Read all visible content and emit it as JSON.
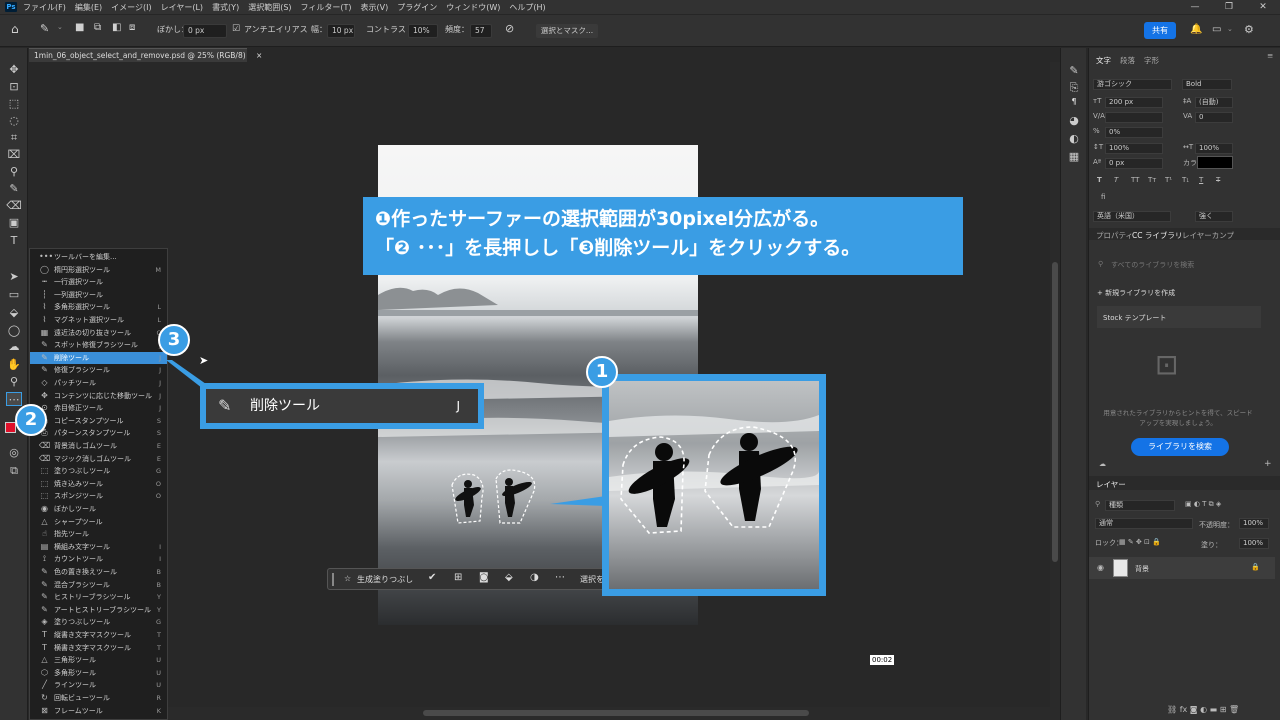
{
  "menu": {
    "app_icon": "Ps",
    "items": [
      "ファイル(F)",
      "編集(E)",
      "イメージ(I)",
      "レイヤー(L)",
      "書式(Y)",
      "選択範囲(S)",
      "フィルター(T)",
      "表示(V)",
      "プラグイン",
      "ウィンドウ(W)",
      "ヘルプ(H)"
    ]
  },
  "options": {
    "feather_label": "ぼかし：",
    "feather_value": "0 px",
    "antialias_label": "アンチエイリアス",
    "width_label": "幅：",
    "width_value": "10 px",
    "contrast_label": "コントラスト：",
    "contrast_value": "10%",
    "frequency_label": "頻度：",
    "frequency_value": "57",
    "select_mask_button": "選択とマスク...",
    "share_button": "共有"
  },
  "document": {
    "tab_title": "1min_06_object_select_and_remove.psd @ 25% (RGB/8)",
    "close": "×"
  },
  "flyout": {
    "items": [
      {
        "icon": "•••",
        "label": "ツールバーを編集...",
        "key": ""
      },
      {
        "icon": "◯",
        "label": "楕円形選択ツール",
        "key": "M"
      },
      {
        "icon": "┅",
        "label": "一行選択ツール",
        "key": ""
      },
      {
        "icon": "┆",
        "label": "一列選択ツール",
        "key": ""
      },
      {
        "icon": "⌇",
        "label": "多角形選択ツール",
        "key": "L"
      },
      {
        "icon": "⌇",
        "label": "マグネット選択ツール",
        "key": "L"
      },
      {
        "icon": "▦",
        "label": "遠近法の切り抜きツール",
        "key": "C"
      },
      {
        "icon": "✎",
        "label": "スポット修復ブラシツール",
        "key": "J"
      },
      {
        "icon": "✎",
        "label": "削除ツール",
        "key": "J"
      },
      {
        "icon": "✎",
        "label": "修復ブラシツール",
        "key": "J"
      },
      {
        "icon": "◇",
        "label": "パッチツール",
        "key": "J"
      },
      {
        "icon": "✥",
        "label": "コンテンツに応じた移動ツール",
        "key": "J"
      },
      {
        "icon": "⊙",
        "label": "赤目修正ツール",
        "key": "J"
      },
      {
        "icon": "⎙",
        "label": "コピースタンプツール",
        "key": "S"
      },
      {
        "icon": "⎙",
        "label": "パターンスタンプツール",
        "key": "S"
      },
      {
        "icon": "⌫",
        "label": "背景消しゴムツール",
        "key": "E"
      },
      {
        "icon": "⌫",
        "label": "マジック消しゴムツール",
        "key": "E"
      },
      {
        "icon": "⬚",
        "label": "塗りつぶしツール",
        "key": "G"
      },
      {
        "icon": "⬚",
        "label": "焼き込みツール",
        "key": "O"
      },
      {
        "icon": "⬚",
        "label": "スポンジツール",
        "key": "O"
      },
      {
        "icon": "◉",
        "label": "ぼかしツール",
        "key": ""
      },
      {
        "icon": "△",
        "label": "シャープツール",
        "key": ""
      },
      {
        "icon": "☝",
        "label": "指先ツール",
        "key": ""
      },
      {
        "icon": "▤",
        "label": "横組み文字ツール",
        "key": "I"
      },
      {
        "icon": "⟟",
        "label": "カウントツール",
        "key": "I"
      },
      {
        "icon": "✎",
        "label": "色の置き換えツール",
        "key": "B"
      },
      {
        "icon": "✎",
        "label": "混合ブラシツール",
        "key": "B"
      },
      {
        "icon": "✎",
        "label": "ヒストリーブラシツール",
        "key": "Y"
      },
      {
        "icon": "✎",
        "label": "アートヒストリーブラシツール",
        "key": "Y"
      },
      {
        "icon": "◈",
        "label": "塗りつぶしツール",
        "key": "G"
      },
      {
        "icon": "T",
        "label": "縦書き文字マスクツール",
        "key": "T"
      },
      {
        "icon": "T",
        "label": "横書き文字マスクツール",
        "key": "T"
      },
      {
        "icon": "△",
        "label": "三角形ツール",
        "key": "U"
      },
      {
        "icon": "⬡",
        "label": "多角形ツール",
        "key": "U"
      },
      {
        "icon": "╱",
        "label": "ラインツール",
        "key": "U"
      },
      {
        "icon": "↻",
        "label": "回転ビューツール",
        "key": "R"
      },
      {
        "icon": "⊠",
        "label": "フレームツール",
        "key": "K"
      }
    ]
  },
  "annotations": {
    "callout_line1": "❶作ったサーファーの選択範囲が30pixel分広がる。",
    "callout_line2": "「❷ ･･･」を長押しし「❸削除ツール」をクリックする。",
    "badge1": "1",
    "badge2": "2",
    "badge3": "3",
    "popup_label": "削除ツール",
    "popup_key": "J"
  },
  "context_bar": {
    "generative_fill": "生成塗りつぶし",
    "select_more": "選択を..."
  },
  "timestamp": "00:02",
  "right_panel": {
    "tabs": [
      "文字",
      "段落",
      "字形"
    ],
    "font_family": "游ゴシック",
    "font_style": "Bold",
    "font_size": "200 px",
    "leading": "(自動)",
    "tracking": "0",
    "scale_pct": "0%",
    "vscale": "100%",
    "hscale": "100%",
    "baseline": "0 px",
    "color_label": "カラー：",
    "language": "英語（米国）",
    "antialias": "強く",
    "lib_tabs": [
      "プロパティ",
      "CC ライブラリ",
      "レイヤーカンプ"
    ],
    "lib_search_placeholder": "すべてのライブラリを検索",
    "new_library": "+ 新規ライブラリを作成",
    "stock_templates": "Stock テンプレート",
    "lib_empty_text": "用意されたライブラリからヒントを得て、スピードアップを実現しましょう。",
    "browse_button": "ライブラリを検索",
    "layers_tab": "レイヤー",
    "layers_kind": "種類",
    "blend_mode": "通常",
    "opacity_label": "不透明度：",
    "opacity": "100%",
    "lock_label": "ロック：",
    "fill_label": "塗り：",
    "fill": "100%",
    "layer_name": "背景"
  },
  "colors": {
    "accent": "#3a9de4",
    "foreground": "#e0102a",
    "share_button": "#1473e6"
  }
}
